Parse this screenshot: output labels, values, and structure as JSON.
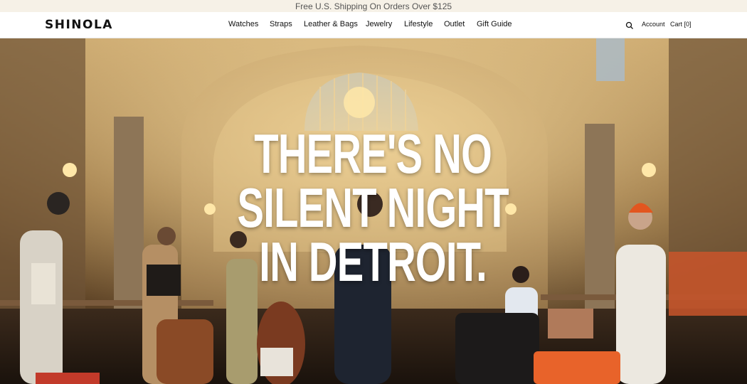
{
  "promo": {
    "text": "Free U.S. Shipping On Orders Over $125"
  },
  "brand": {
    "logo_text": "SHINOLA"
  },
  "nav": {
    "items": [
      {
        "label": "Watches"
      },
      {
        "label": "Straps"
      },
      {
        "label": "Leather & Bags"
      },
      {
        "label": "Jewelry"
      },
      {
        "label": "Lifestyle"
      },
      {
        "label": "Outlet"
      },
      {
        "label": "Gift Guide"
      }
    ]
  },
  "utility": {
    "search_icon": "search-icon",
    "account_label": "Account",
    "cart_label": "Cart",
    "cart_count": "[0]"
  },
  "hero": {
    "headline_lines": [
      "THERE'S NO",
      "SILENT NIGHT",
      "IN DETROIT."
    ],
    "image_description_colors": {
      "warm_wall": "#8a6a3c",
      "ceiling": "#b89763",
      "floor": "#2a1d14",
      "window_blue": "#9fb3c8"
    }
  }
}
